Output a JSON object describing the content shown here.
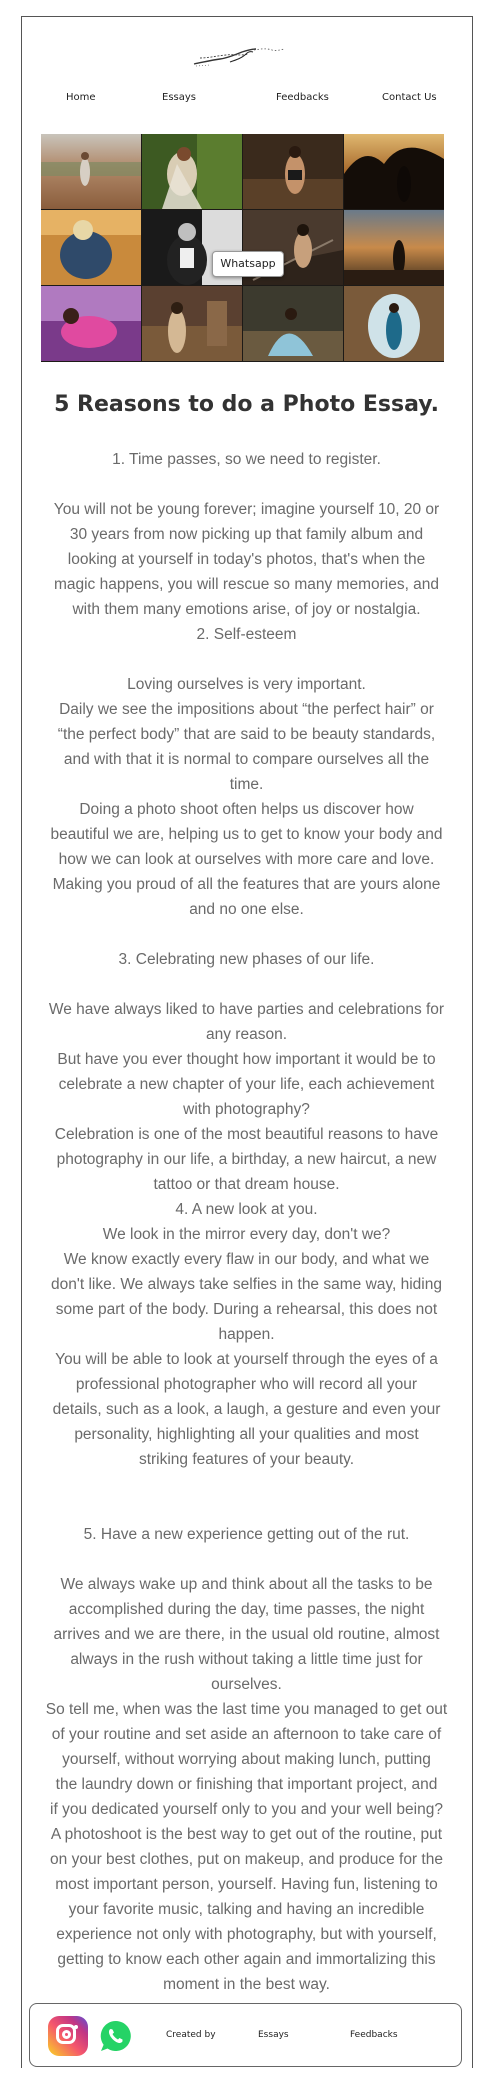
{
  "nav": {
    "items": [
      {
        "label": "Home"
      },
      {
        "label": "Essays"
      },
      {
        "label": "Feedbacks"
      },
      {
        "label": "Contact Us"
      }
    ]
  },
  "gallery": {
    "whatsapp_label": "Whatsapp"
  },
  "article": {
    "title": "5 Reasons to do a Photo Essay.",
    "lines": [
      "1. Time passes, so we need to register.",
      "",
      "You will not be young forever; imagine yourself 10, 20 or",
      "30 years from now picking up that family album and",
      "looking at yourself in today's photos, that's when the",
      "magic happens, you will rescue so many memories, and",
      "with them many emotions arise, of joy or nostalgia.",
      "2. Self-esteem",
      "",
      "Loving ourselves is very important.",
      "Daily we see the impositions about “the perfect hair” or",
      "“the perfect body” that are said to be beauty standards,",
      "and with that it is normal to compare ourselves all the",
      "time.",
      "Doing a photo shoot often helps us discover how",
      "beautiful we are, helping us to get to know your body and",
      "how we can look at ourselves with more care and love.",
      "Making you proud of all the features that are yours alone",
      "and no one else.",
      "",
      "3. Celebrating new phases of our life.",
      "",
      "We have always liked to have parties and celebrations for",
      "any reason.",
      "But have you ever thought how important it would be to",
      "celebrate a new chapter of your life, each achievement",
      "with photography?",
      "Celebration is one of the most beautiful reasons to have",
      "photography in our life, a birthday, a new haircut, a new",
      "tattoo or that dream house.",
      "4. A new look at you.",
      "We look in the mirror every day, don't we?",
      "We know exactly every flaw in our body, and what we",
      "don't like. We always take selfies in the same way, hiding",
      "some part of the body. During a rehearsal, this does not",
      "happen.",
      "You will be able to look at yourself through the eyes of a",
      "professional photographer who will record all your",
      "details, such as a look, a laugh, a gesture and even your",
      "personality, highlighting all your qualities and most",
      "striking features of your beauty.",
      "",
      "",
      "5. Have a new experience getting out of the rut.",
      "",
      "We always wake up and think about all the tasks to be",
      "accomplished during the day, time passes, the night",
      "arrives and we are there, in the usual old routine, almost",
      "always in the rush without taking a little time just for",
      "ourselves.",
      "So tell me, when was the last time you managed to get out",
      "of your routine and set aside an afternoon to take care of",
      "yourself, without worrying about making lunch, putting",
      "the laundry down or finishing that important project, and",
      "if you dedicated yourself only to you and your well being?",
      "A photoshoot is the best way to get out of the routine, put",
      "on your best clothes, put on makeup, and produce for the",
      "most important person, yourself. Having fun, listening to",
      "your favorite music, talking and having an incredible",
      "experience not only with photography, but with yourself,",
      "getting to know each other again and immortalizing this",
      "moment in the best way."
    ]
  },
  "footer": {
    "created_by": "Created by",
    "essays": "Essays",
    "feedbacks": "Feedbacks"
  },
  "colors": {
    "text_gray": "#6a6a6a",
    "title": "#333333",
    "whatsapp_green": "#25d366"
  },
  "icons": [
    "signature-logo",
    "instagram-icon",
    "whatsapp-icon"
  ]
}
